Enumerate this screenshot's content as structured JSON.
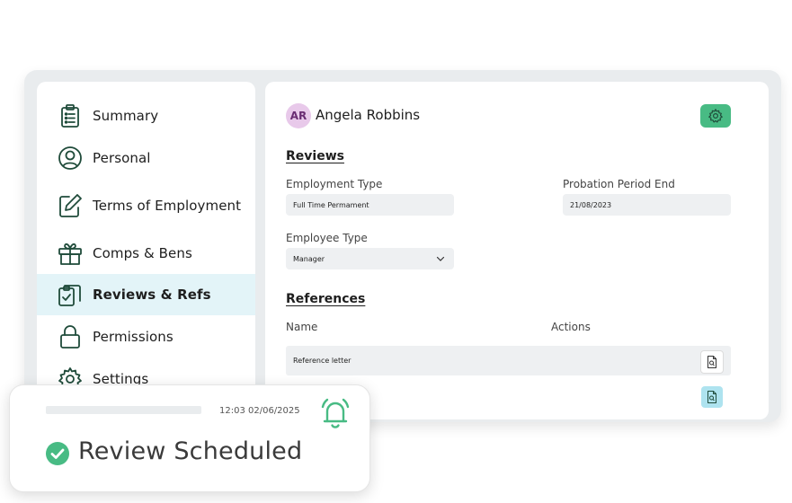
{
  "sidebar": {
    "items": [
      {
        "label": "Summary",
        "icon": "clipboard-list-icon"
      },
      {
        "label": "Personal",
        "icon": "user-circle-icon"
      },
      {
        "label": "Terms of Employment",
        "icon": "edit-icon"
      },
      {
        "label": "Comps & Bens",
        "icon": "gift-icon"
      },
      {
        "label": "Reviews & Refs",
        "icon": "clipboard-check-icon",
        "active": true
      },
      {
        "label": "Permissions",
        "icon": "lock-icon"
      },
      {
        "label": "Settings",
        "icon": "gear-icon"
      }
    ]
  },
  "header": {
    "avatar_initials": "AR",
    "user_name": "Angela Robbins",
    "settings_icon": "gear-icon"
  },
  "reviews": {
    "title": "Reviews",
    "employment_type": {
      "label": "Employment Type",
      "value": "Full Time Permament"
    },
    "probation_end": {
      "label": "Probation Period End",
      "value": "21/08/2023"
    },
    "employee_type": {
      "label": "Employee Type",
      "value": "Manager"
    }
  },
  "references": {
    "title": "References",
    "columns": [
      "Name",
      "Actions"
    ],
    "rows": [
      {
        "name": "Reference letter"
      }
    ]
  },
  "notification": {
    "time": "12:03 02/06/2025",
    "title": "Review Scheduled",
    "icon": "bell-icon",
    "status_icon": "check-circle-icon"
  },
  "colors": {
    "accent_green": "#48bb84",
    "icon_dark_green": "#1f4b3a",
    "active_bg": "#e3f4f8",
    "avatar_bg": "#e8c9ea"
  }
}
